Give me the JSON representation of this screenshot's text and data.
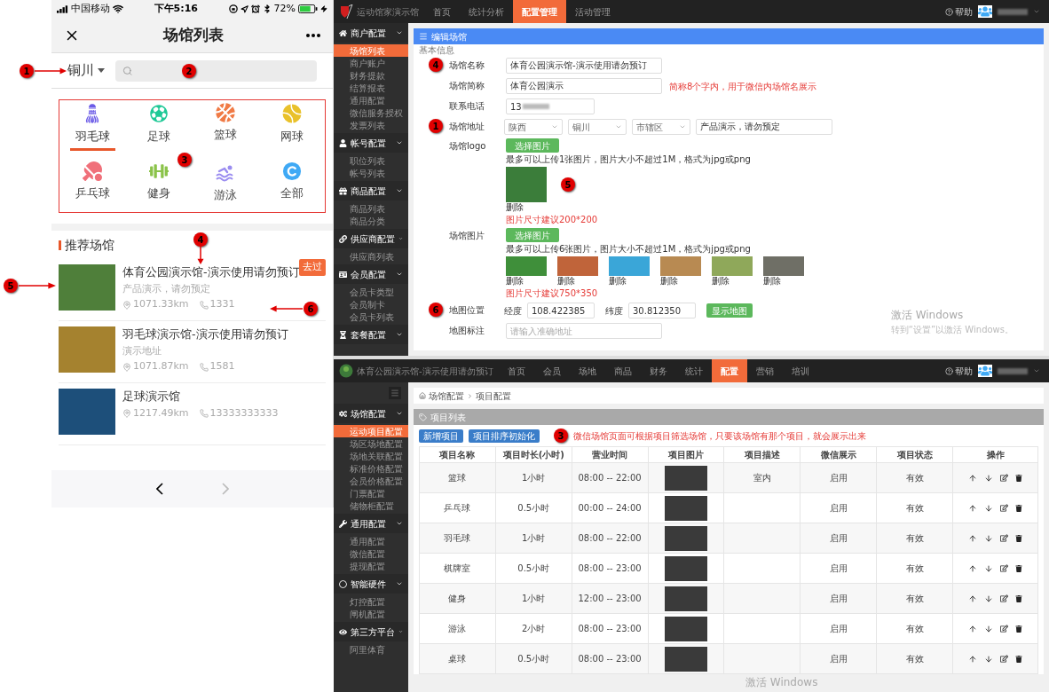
{
  "phone": {
    "status_bar": {
      "carrier": "中国移动",
      "time": "下午5:16",
      "battery": "72%"
    },
    "nav": {
      "title": "场馆列表"
    },
    "city": {
      "label": "铜川",
      "marker": "1"
    },
    "search": {
      "marker": "2"
    },
    "categories": {
      "marker": "3",
      "items": [
        {
          "label": "羽毛球",
          "selected": true
        },
        {
          "label": "足球",
          "selected": false
        },
        {
          "label": "篮球",
          "selected": false
        },
        {
          "label": "网球",
          "selected": false
        },
        {
          "label": "乒乓球",
          "selected": false
        },
        {
          "label": "健身",
          "selected": false
        },
        {
          "label": "游泳",
          "selected": false
        },
        {
          "label": "全部",
          "selected": false
        }
      ]
    },
    "section_title": "推荐场馆",
    "venues": [
      {
        "name": "体育公园演示馆-演示使用请勿预订",
        "address": "产品演示，请勿预定",
        "distance": "1071.33km",
        "phone": "1331",
        "badge": "去过",
        "markers": {
          "name": "4",
          "image": "5",
          "meta": "6"
        }
      },
      {
        "name": "羽毛球演示馆-演示使用请勿预订",
        "address": "演示地址",
        "distance": "1071.87km",
        "phone": "1581"
      },
      {
        "name": "足球演示馆",
        "distance": "1217.49km",
        "phone": "13333333333"
      }
    ],
    "pager": {
      "prev": {
        "disabled": false
      },
      "next": {
        "disabled": true
      }
    }
  },
  "admin_edit": {
    "logo_text": "运动馆家演示馆",
    "help": "帮助",
    "nav": [
      {
        "label": "首页",
        "selected": false
      },
      {
        "label": "统计分析",
        "selected": false
      },
      {
        "label": "配置管理",
        "selected": true
      },
      {
        "label": "活动管理",
        "selected": false
      }
    ],
    "sidebar": [
      {
        "label": "商户配置",
        "expanded": true,
        "children": [
          {
            "label": "场馆列表",
            "selected": true
          },
          {
            "label": "商户账户",
            "selected": false
          },
          {
            "label": "财务提款",
            "selected": false
          },
          {
            "label": "结算报表",
            "selected": false
          },
          {
            "label": "通用配置",
            "selected": false
          },
          {
            "label": "微信服务授权",
            "selected": false
          },
          {
            "label": "发票列表",
            "selected": false
          }
        ]
      },
      {
        "label": "帐号配置",
        "expanded": true,
        "children": [
          {
            "label": "职位列表",
            "selected": false
          },
          {
            "label": "帐号列表",
            "selected": false
          }
        ]
      },
      {
        "label": "商品配置",
        "expanded": true,
        "children": [
          {
            "label": "商品列表",
            "selected": false
          },
          {
            "label": "商品分类",
            "selected": false
          }
        ]
      },
      {
        "label": "供应商配置",
        "expanded": true,
        "children": [
          {
            "label": "供应商列表",
            "selected": false
          }
        ]
      },
      {
        "label": "会员配置",
        "expanded": true,
        "children": [
          {
            "label": "会员卡类型",
            "selected": false
          },
          {
            "label": "会员制卡",
            "selected": false
          },
          {
            "label": "会员卡列表",
            "selected": false
          }
        ]
      },
      {
        "label": "套餐配置",
        "expanded": true
      }
    ],
    "panel_title": "编辑场馆",
    "section": "基本信息",
    "fields": [
      {
        "kind": "text",
        "label": "场馆名称",
        "value": "体育公园演示馆-演示使用请勿预订",
        "marker": "4"
      },
      {
        "kind": "text",
        "label": "场馆简称",
        "value": "体育公园演示",
        "hint": "简称8个字内，用于微信内场馆名展示"
      },
      {
        "kind": "text",
        "label": "联系电话",
        "value": "13",
        "blurred": true
      },
      {
        "kind": "address",
        "label": "场馆地址",
        "marker": "1",
        "selects": [
          "陕西",
          "铜川",
          "市辖区"
        ],
        "value": "产品演示，请勿预定"
      },
      {
        "kind": "logo",
        "label": "场馆logo",
        "button": "选择图片",
        "note": "最多可以上传1张图片，图片大小不超过1M，格式为jpg或png",
        "images": [
          {
            "delete": "删除",
            "marker": "5"
          }
        ],
        "size_hint": "图片尺寸建议200*200"
      },
      {
        "kind": "gallery",
        "label": "场馆图片",
        "button": "选择图片",
        "note": "最多可以上传6张图片，图片大小不超过1M，格式为jpg或png",
        "images": [
          {
            "delete": "删除"
          },
          {
            "delete": "删除"
          },
          {
            "delete": "删除"
          },
          {
            "delete": "删除"
          },
          {
            "delete": "删除"
          },
          {
            "delete": "删除"
          }
        ],
        "size_hint": "图片尺寸建议750*350"
      },
      {
        "kind": "map",
        "label": "地图位置",
        "marker": "6",
        "lng_label": "经度",
        "lng": "108.422385",
        "lat_label": "纬度",
        "lat": "30.812350",
        "button": "显示地图"
      },
      {
        "kind": "text",
        "label": "地图标注",
        "placeholder": "请输入准确地址"
      }
    ],
    "os_notice": {
      "title": "激活 Windows",
      "subtitle": "转到“设置”以激活 Windows。"
    }
  },
  "admin_list": {
    "logo_text": "体育公园演示馆-演示使用请勿预订",
    "help": "帮助",
    "nav": [
      {
        "label": "首页",
        "selected": false
      },
      {
        "label": "会员",
        "selected": false
      },
      {
        "label": "场地",
        "selected": false
      },
      {
        "label": "商品",
        "selected": false
      },
      {
        "label": "财务",
        "selected": false
      },
      {
        "label": "统计",
        "selected": false
      },
      {
        "label": "配置",
        "selected": true
      },
      {
        "label": "营销",
        "selected": false
      },
      {
        "label": "培训",
        "selected": false
      }
    ],
    "sidebar": [
      {
        "label": "场馆配置",
        "expanded": true,
        "children": [
          {
            "label": "运动项目配置",
            "selected": true
          },
          {
            "label": "场区场地配置",
            "selected": false
          },
          {
            "label": "场地关联配置",
            "selected": false
          },
          {
            "label": "标准价格配置",
            "selected": false
          },
          {
            "label": "会员价格配置",
            "selected": false
          },
          {
            "label": "门票配置",
            "selected": false
          },
          {
            "label": "储物柜配置",
            "selected": false
          }
        ]
      },
      {
        "label": "通用配置",
        "expanded": true,
        "children": [
          {
            "label": "通用配置",
            "selected": false
          },
          {
            "label": "微信配置",
            "selected": false
          },
          {
            "label": "提现配置",
            "selected": false
          }
        ]
      },
      {
        "label": "智能硬件",
        "expanded": true,
        "children": [
          {
            "label": "灯控配置",
            "selected": false
          },
          {
            "label": "闸机配置",
            "selected": false
          }
        ]
      },
      {
        "label": "第三方平台",
        "expanded": true,
        "children": [
          {
            "label": "阿里体育",
            "selected": false
          }
        ]
      }
    ],
    "breadcrumb": [
      "场馆配置",
      "项目配置"
    ],
    "panel_title": "项目列表",
    "buttons": [
      "新增项目",
      "项目排序初始化"
    ],
    "marker": "3",
    "note": "微信场馆页面可根据项目筛选场馆，只要该场馆有那个项目，就会展示出来",
    "columns": [
      "项目名称",
      "项目时长(小时)",
      "营业时间",
      "项目图片",
      "项目描述",
      "微信展示",
      "项目状态",
      "操作"
    ],
    "rows": [
      {
        "name": "篮球",
        "duration": "1小时",
        "hours": "08:00 -- 22:00",
        "description": "室内",
        "wechat": "启用",
        "status": "有效"
      },
      {
        "name": "乒乓球",
        "duration": "0.5小时",
        "hours": "00:00 -- 24:00",
        "wechat": "启用",
        "status": "有效"
      },
      {
        "name": "羽毛球",
        "duration": "1小时",
        "hours": "08:00 -- 22:00",
        "wechat": "启用",
        "status": "有效"
      },
      {
        "name": "棋牌室",
        "duration": "0.5小时",
        "hours": "08:00 -- 23:00",
        "wechat": "启用",
        "status": "有效"
      },
      {
        "name": "健身",
        "duration": "1小时",
        "hours": "12:00 -- 23:00",
        "wechat": "启用",
        "status": "有效"
      },
      {
        "name": "游泳",
        "duration": "2小时",
        "hours": "08:00 -- 23:00",
        "wechat": "启用",
        "status": "有效"
      },
      {
        "name": "桌球",
        "duration": "0.5小时",
        "hours": "08:00 -- 23:00",
        "wechat": "启用",
        "status": "有效"
      }
    ],
    "os_notice": {
      "title": "激活 Windows"
    }
  }
}
